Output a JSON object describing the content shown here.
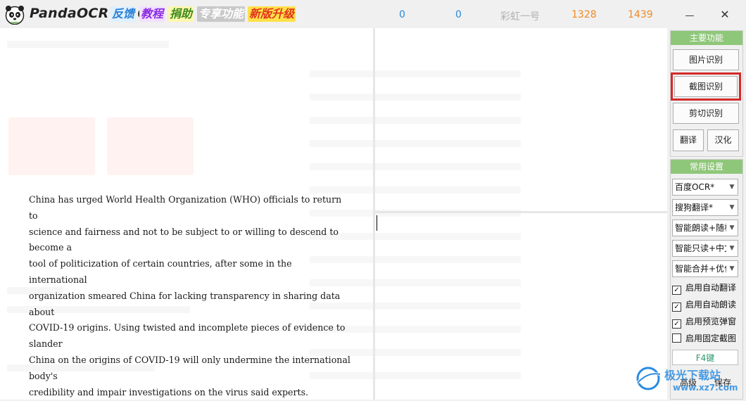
{
  "app": {
    "title": "PandaOCR v2.6",
    "badges": [
      "反馈",
      "教程",
      "捐助",
      "专享功能",
      "新版升级"
    ]
  },
  "counters": {
    "c1": "0",
    "c2": "0",
    "rainbow": "彩虹一号",
    "c3": "1328",
    "c4": "1439"
  },
  "window": {
    "minimize": "—",
    "close": "✕"
  },
  "ocr_text": "China has urged World Health Organization (WHO) officials to return to\nscience and fairness and not to be subject to or willing to descend to become a\ntool of politicization of certain countries, after some in the international\norganization smeared China for lacking transparency in sharing data about\nCOVID-19 origins. Using twisted and incomplete pieces of evidence to slander\nChina on the origins of COVID-19 will only undermine the international body's\ncredibility and impair investigations on the virus said experts.",
  "panel": {
    "main_header": "主要功能",
    "btn_image": "图片识别",
    "btn_screenshot": "截图识别",
    "btn_clip": "剪切识别",
    "btn_translate": "翻译",
    "btn_localize": "汉化",
    "settings_header": "常用设置",
    "select_ocr": "百度OCR*",
    "select_translate": "搜狗翻译*",
    "select_read": "智能朗读+随机",
    "select_readonly": "智能只读+中文",
    "select_merge": "智能合并+优化",
    "chk_auto_translate": "启用自动翻译",
    "chk_auto_read": "启用自动朗读",
    "chk_preview": "启用预览弹窗",
    "chk_fixed": "启用固定截图",
    "hotkey": "F4键",
    "btn_advanced": "高级",
    "btn_save": "保存"
  },
  "checkbox_states": {
    "auto_translate": true,
    "auto_read": true,
    "preview": true,
    "fixed": false
  },
  "watermark": {
    "brand": "极光下载站",
    "url": "www.xz7.com"
  },
  "colors": {
    "accent_green": "#8fc77a",
    "counter_blue": "#2b8ad6",
    "counter_orange": "#f08a24",
    "highlight_red": "#d42a2a"
  }
}
